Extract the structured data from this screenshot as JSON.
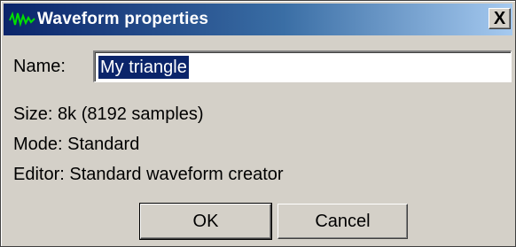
{
  "window": {
    "title": "Waveform properties",
    "title_icon": "waveform-icon",
    "close_label": "X"
  },
  "form": {
    "name_label": "Name:",
    "name_value": "My triangle",
    "size_text": "Size: 8k (8192 samples)",
    "mode_text": "Mode: Standard",
    "editor_text": "Editor: Standard waveform creator"
  },
  "buttons": {
    "ok_label": "OK",
    "cancel_label": "Cancel"
  },
  "colors": {
    "titlebar_start": "#0a246a",
    "titlebar_end": "#a6caf0",
    "face": "#d4d0c8",
    "selection": "#0a246a"
  }
}
